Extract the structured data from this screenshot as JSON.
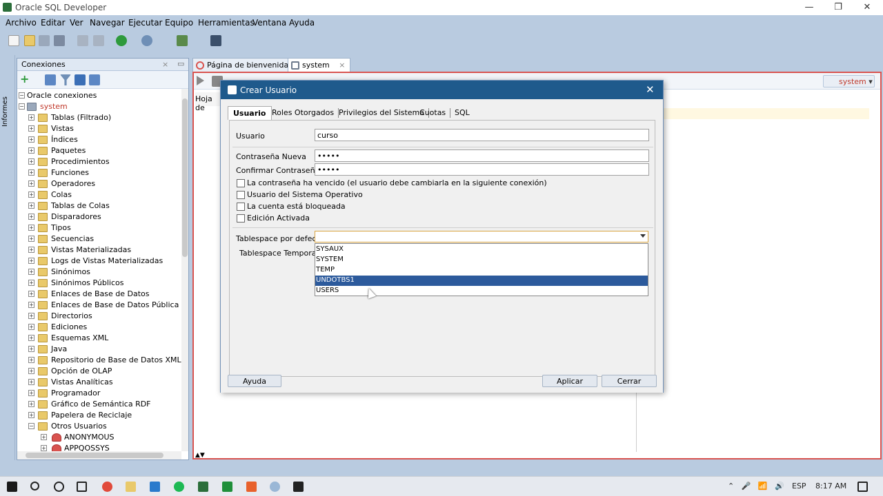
{
  "window": {
    "title": "Oracle SQL Developer"
  },
  "menu": [
    "Archivo",
    "Editar",
    "Ver",
    "Navegar",
    "Ejecutar",
    "Equipo",
    "Herramientas",
    "Ventana",
    "Ayuda"
  ],
  "sidestrip": {
    "label": "Informes"
  },
  "connections": {
    "title": "Conexiones",
    "root": "Oracle conexiones",
    "connection": "system",
    "items": [
      "Tablas (Filtrado)",
      "Vistas",
      "Índices",
      "Paquetes",
      "Procedimientos",
      "Funciones",
      "Operadores",
      "Colas",
      "Tablas de Colas",
      "Disparadores",
      "Tipos",
      "Secuencias",
      "Vistas Materializadas",
      "Logs de Vistas Materializadas",
      "Sinónimos",
      "Sinónimos Públicos",
      "Enlaces de Base de Datos",
      "Enlaces de Base de Datos Pública",
      "Directorios",
      "Ediciones",
      "Esquemas XML",
      "Java",
      "Repositorio de Base de Datos XML",
      "Opción de OLAP",
      "Vistas Analíticas",
      "Programador",
      "Gráfico de Semántica RDF",
      "Papelera de Reciclaje",
      "Otros Usuarios"
    ],
    "other_users": [
      "ANONYMOUS",
      "APPQOSSYS"
    ]
  },
  "editor": {
    "tabs": [
      {
        "label": "Página de bienvenida"
      },
      {
        "label": "system"
      }
    ],
    "connection_selector": "system",
    "sheet_tab": "Hoja de"
  },
  "dialog": {
    "title": "Crear Usuario",
    "tabs": [
      "Usuario",
      "Roles Otorgados",
      "Privilegios del Sistema",
      "Cuotas",
      "SQL"
    ],
    "fields": {
      "user_label": "Usuario",
      "user_value": "curso",
      "new_password_label": "Contraseña Nueva",
      "new_password_value": "•••••",
      "confirm_password_label": "Confirmar Contraseña",
      "confirm_password_value": "•••••"
    },
    "checkboxes": [
      "La contraseña ha vencido (el usuario debe cambiarla en la siguiente conexión)",
      "Usuario del Sistema Operativo",
      "La cuenta está bloqueada",
      "Edición Activada"
    ],
    "default_tablespace_label": "Tablespace por defecto",
    "temp_tablespace_label": "Tablespace Temporal",
    "tablespace_options": [
      "SYSAUX",
      "SYSTEM",
      "TEMP",
      "UNDOTBS1",
      "USERS"
    ],
    "highlighted_option": "UNDOTBS1",
    "buttons": {
      "help": "Ayuda",
      "apply": "Aplicar",
      "close": "Cerrar"
    }
  },
  "taskbar": {
    "language": "ESP",
    "time": "8:17 AM"
  },
  "colors": {
    "dialog_header": "#1f5a8c",
    "selection": "#2c5a9c",
    "editor_border": "#d9534f",
    "chrome": "#b9cbe0"
  }
}
